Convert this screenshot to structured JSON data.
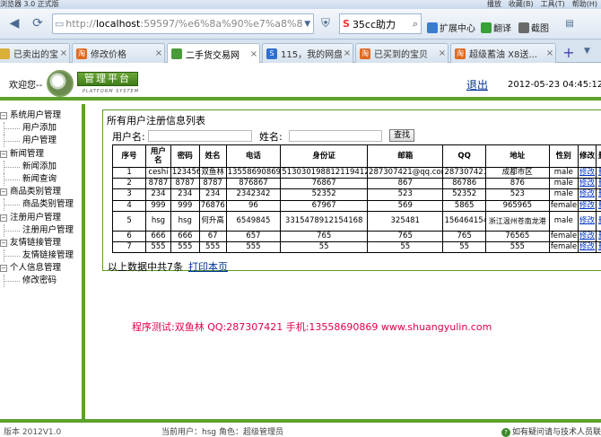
{
  "browser": {
    "app_title": "浏览器 3.0 正式版",
    "title_right": [
      "播放",
      "收藏(B)",
      "工具(T)",
      "帮助(H)"
    ],
    "address": {
      "prefix": "http://",
      "host": "localhost",
      "rest": ":59597/%e6%8a%90%e7%a8%8b%e5"
    },
    "search_text": "35cc助力",
    "extensions": [
      "扩展中心",
      "翻译",
      "截图"
    ],
    "tabs": [
      {
        "label": "已卖出的宝贝",
        "icon_color": "#d9b038",
        "icon_text": ""
      },
      {
        "label": "修改价格",
        "icon_color": "#e06a20",
        "icon_text": "淘"
      },
      {
        "label": "二手货交易网",
        "icon_color": "#4a9a3a",
        "icon_text": ""
      },
      {
        "label": "115，我的网盘...",
        "icon_color": "#2e6fcf",
        "icon_text": "S"
      },
      {
        "label": "已买到的宝贝",
        "icon_color": "#e06a20",
        "icon_text": "淘"
      },
      {
        "label": "超级蓄油 X8送...",
        "icon_color": "#e06a20",
        "icon_text": "淘"
      }
    ],
    "active_tab": 2
  },
  "header": {
    "welcome": "欢迎您--",
    "logo_text": "管理平台",
    "logo_sub": "PLATFORM SYSTEM",
    "logout": "退出",
    "datetime": "2012-05-23 04:45:12 PM"
  },
  "sidebar": {
    "groups": [
      {
        "label": "系统用户管理",
        "items": [
          "用户添加",
          "用户管理"
        ]
      },
      {
        "label": "新闻管理",
        "items": [
          "新闻添加",
          "新闻查询"
        ]
      },
      {
        "label": "商品类别管理",
        "items": [
          "商品类别管理"
        ]
      },
      {
        "label": "注册用户管理",
        "items": [
          "注册用户管理"
        ]
      },
      {
        "label": "友情链接管理",
        "items": [
          "友情链接管理"
        ]
      },
      {
        "label": "个人信息管理",
        "items": [
          "修改密码"
        ]
      }
    ]
  },
  "main": {
    "panel_title": "所有用户注册信息列表",
    "search": {
      "username_label": "用户名:",
      "name_label": "姓名:",
      "button": "查找"
    },
    "table": {
      "headers": [
        "序号",
        "用户名",
        "密码",
        "姓名",
        "电话",
        "身份证",
        "邮箱",
        "QQ",
        "地址",
        "性别",
        "修改",
        "删除"
      ],
      "rows": [
        [
          "1",
          "ceshi",
          "123456",
          "双鱼林",
          "13558690869",
          "513030198812119412",
          "287307421@qq.com",
          "287307421",
          "成都市区",
          "male",
          "修改",
          "删除"
        ],
        [
          "2",
          "8787",
          "8787",
          "8787",
          "876867",
          "76867",
          "867",
          "86786",
          "876",
          "male",
          "修改",
          "删除"
        ],
        [
          "3",
          "234",
          "234",
          "234",
          "2342342",
          "52352",
          "523",
          "52352",
          "523",
          "male",
          "修改",
          "删除"
        ],
        [
          "4",
          "999",
          "999",
          "76876",
          "96",
          "67967",
          "569",
          "5865",
          "965965",
          "female",
          "修改",
          "删除"
        ],
        [
          "5",
          "hsg",
          "hsg",
          "何升高",
          "6549845",
          "3315478912154168",
          "325481",
          "156464154",
          "浙江温州苍南龙港",
          "male",
          "修改",
          "删除"
        ],
        [
          "6",
          "666",
          "666",
          "67",
          "657",
          "765",
          "765",
          "765",
          "76565",
          "female",
          "修改",
          "删除"
        ],
        [
          "7",
          "555",
          "555",
          "555",
          "555",
          "55",
          "55",
          "55",
          "555",
          "female",
          "修改",
          "删除"
        ]
      ]
    },
    "summary": "以上数据中共7条",
    "print": "打印本页",
    "promo": "程序测试:双鱼林 QQ:287307421 手机:13558690869 www.shuangyulin.com"
  },
  "statusbar": {
    "version": "版本 2012V1.0",
    "user_info": "当前用户：hsg 角色：超级管理员",
    "help": "如有疑问请与技术人员联系"
  }
}
